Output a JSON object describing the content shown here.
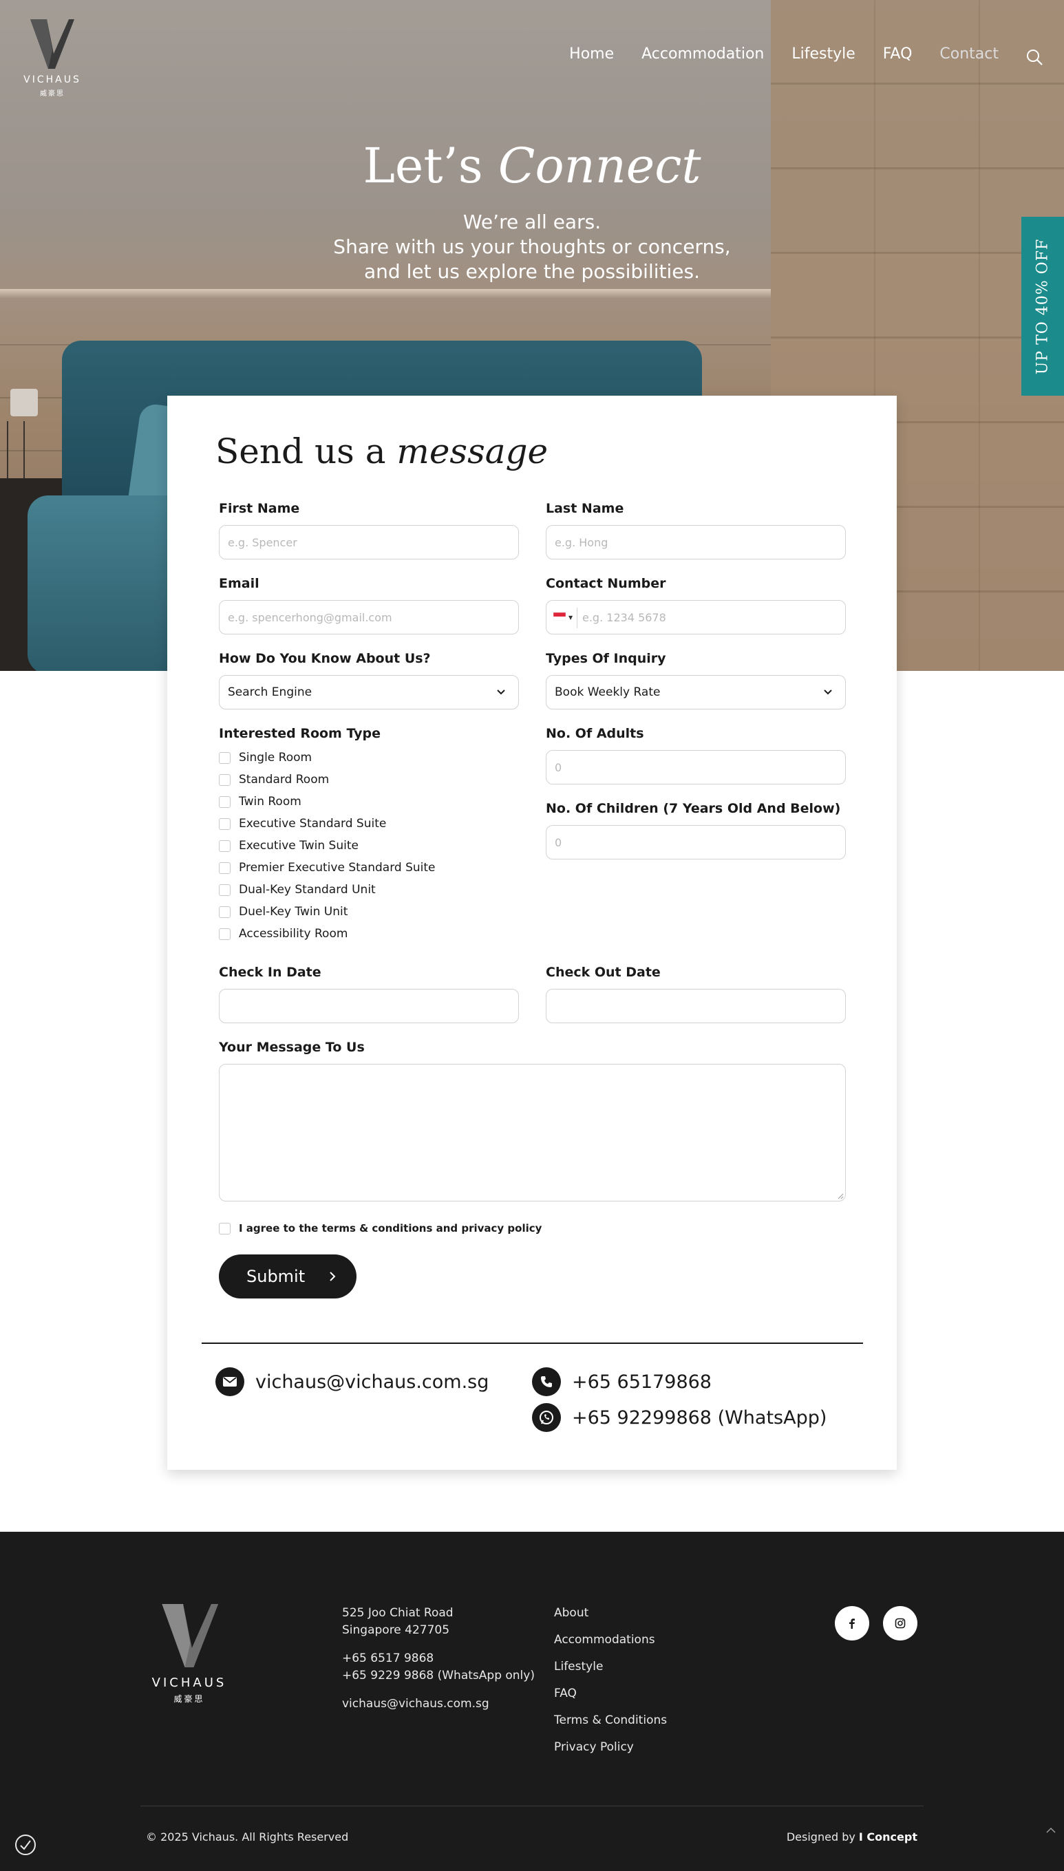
{
  "brand": {
    "name": "VICHAUS",
    "chinese": "威豪思"
  },
  "nav": {
    "items": [
      "Home",
      "Accommodation",
      "Lifestyle",
      "FAQ",
      "Contact"
    ],
    "active": "Contact",
    "search_icon": "search-icon"
  },
  "hero": {
    "title_plain": "Let’s ",
    "title_italic": "Connect",
    "subtitle_lines": [
      "We’re all ears.",
      "Share with us your thoughts or concerns,",
      "and let us explore the possibilities."
    ]
  },
  "promo_tab": {
    "label": "UP TO 40% OFF",
    "color": "#1c8b8c"
  },
  "form": {
    "title_plain": "Send us a ",
    "title_italic": "message",
    "first_name": {
      "label": "First Name",
      "placeholder": "e.g. Spencer"
    },
    "last_name": {
      "label": "Last Name",
      "placeholder": "e.g. Hong"
    },
    "email": {
      "label": "Email",
      "placeholder": "e.g. spencerhong@gmail.com"
    },
    "contact_number": {
      "label": "Contact Number",
      "placeholder": "e.g. 1234 5678",
      "country_flag": "singapore-flag-icon"
    },
    "how_know": {
      "label": "How Do You Know About Us?",
      "value": "Search Engine"
    },
    "inquiry_type": {
      "label": "Types Of Inquiry",
      "value": "Book Weekly Rate"
    },
    "room_type": {
      "label": "Interested Room Type",
      "options": [
        "Single Room",
        "Standard Room",
        "Twin Room",
        "Executive Standard Suite",
        "Executive Twin Suite",
        "Premier Executive Standard Suite",
        "Dual-Key Standard Unit",
        "Duel-Key Twin Unit",
        "Accessibility Room"
      ]
    },
    "adults": {
      "label": "No. Of Adults",
      "placeholder": "0"
    },
    "children": {
      "label": "No. Of Children (7 Years Old And Below)",
      "placeholder": "0"
    },
    "check_in": {
      "label": "Check In Date"
    },
    "check_out": {
      "label": "Check Out Date"
    },
    "message": {
      "label": "Your Message To Us"
    },
    "agree": "I agree to the terms & conditions and privacy policy",
    "submit": "Submit"
  },
  "contact": {
    "email": "vichaus@vichaus.com.sg",
    "phone": "+65 65179868",
    "whatsapp": "+65 92299868 (WhatsApp)"
  },
  "footer": {
    "address_lines": [
      "525 Joo Chiat Road",
      "Singapore 427705"
    ],
    "phone_lines": [
      "+65 6517 9868",
      "+65 9229 9868 (WhatsApp only)"
    ],
    "email": "vichaus@vichaus.com.sg",
    "links": [
      "About",
      "Accommodations",
      "Lifestyle",
      "FAQ",
      "Terms & Conditions",
      "Privacy Policy"
    ],
    "copyright": "© 2025 Vichaus. All Rights Reserved",
    "designed_prefix": "Designed by ",
    "designed_by": "I Concept",
    "social": [
      "facebook-icon",
      "instagram-icon"
    ]
  },
  "colors": {
    "accent": "#1c8b8c",
    "dark": "#1a1a1a",
    "footer_bg": "#1b1b1b"
  }
}
